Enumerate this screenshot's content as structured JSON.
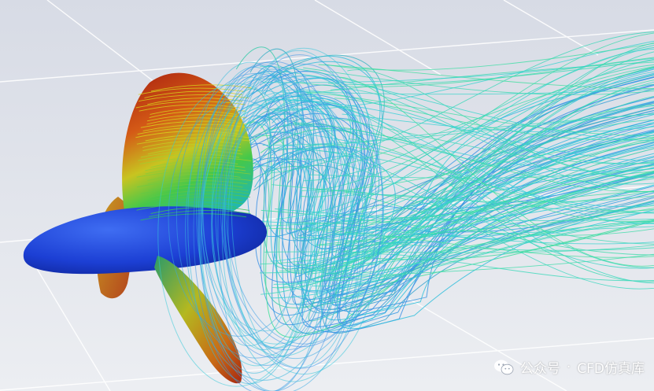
{
  "watermark": {
    "platform": "公众号",
    "separator": "·",
    "account": "CFD仿真库",
    "icon": "wechat-icon"
  },
  "colors": {
    "background": "#e2e5ec",
    "grid_line": "#ffffff",
    "hub": "#1a3fd6",
    "blade_hot": "#c83216",
    "blade_mid": "#d8d21c",
    "blade_cool": "#27c25a",
    "stream_cyan": "#33d0d8",
    "stream_blue": "#3d8fe8",
    "stream_green": "#3fe09a"
  }
}
